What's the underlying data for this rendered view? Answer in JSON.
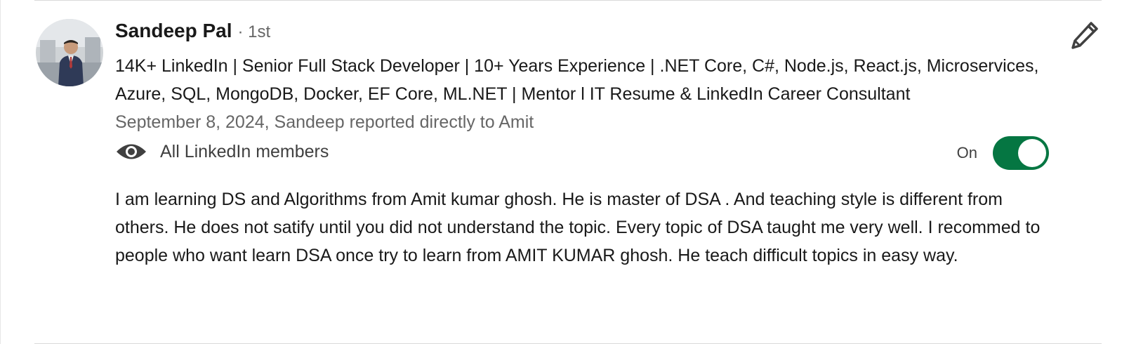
{
  "recommender": {
    "name": "Sandeep Pal",
    "degree": "· 1st",
    "headline": "14K+ LinkedIn | Senior Full Stack Developer | 10+ Years Experience | .NET Core, C#, Node.js, React.js, Microservices, Azure, SQL, MongoDB, Docker, EF Core, ML.NET | Mentor l IT Resume & LinkedIn Career Consultant",
    "date_relation": "September 8, 2024, Sandeep reported directly to Amit",
    "avatar_icon": "profile-photo"
  },
  "visibility": {
    "icon": "eye-icon",
    "label": "All LinkedIn members",
    "toggle_state": "On",
    "toggle_on": true,
    "toggle_color": "#057642"
  },
  "recommendation": {
    "text": "I am learning DS and Algorithms from Amit kumar ghosh. He is master of DSA . And teaching style is different from others. He does not satify until you did not understand the topic. Every topic of DSA taught me very well. I recommed to people who want learn DSA once try to learn from AMIT KUMAR ghosh. He teach difficult topics in easy way."
  },
  "actions": {
    "edit_icon": "pencil-icon"
  }
}
